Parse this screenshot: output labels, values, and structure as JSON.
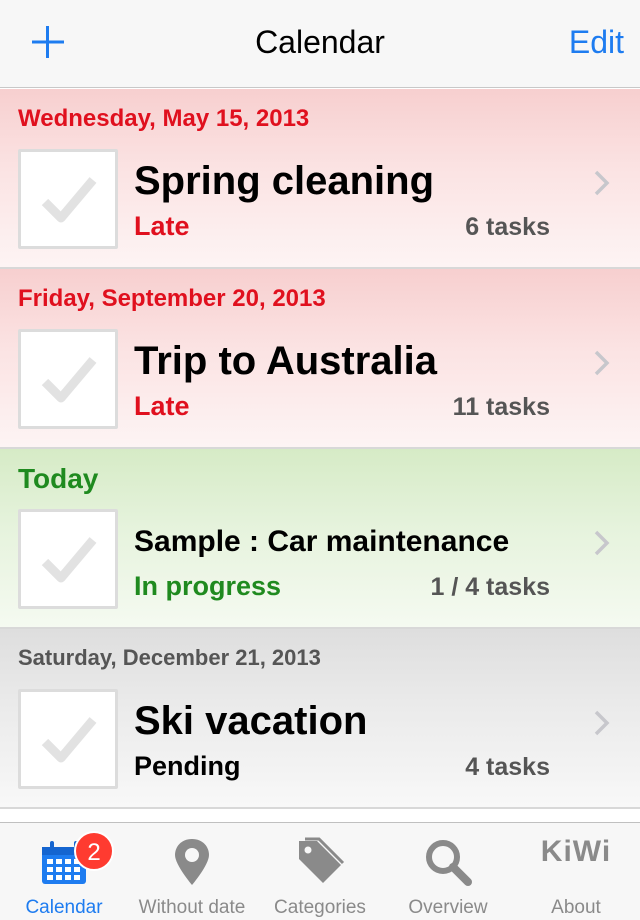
{
  "navbar": {
    "title": "Calendar",
    "edit_label": "Edit",
    "add_icon": "plus-icon",
    "accent": "#1e7cf0"
  },
  "sections": [
    {
      "date": "Wednesday, May 15, 2013",
      "title": "Spring cleaning",
      "status": "Late",
      "count": "6 tasks",
      "kind": "late"
    },
    {
      "date": "Friday, September 20, 2013",
      "title": "Trip to Australia",
      "status": "Late",
      "count": "11 tasks",
      "kind": "late"
    },
    {
      "date": "Today",
      "title": "Sample : Car maintenance",
      "status": "In progress",
      "count": "1 / 4 tasks",
      "kind": "today"
    },
    {
      "date": "Saturday, December 21, 2013",
      "title": "Ski vacation",
      "status": "Pending",
      "count": "4 tasks",
      "kind": "pending"
    }
  ],
  "colors": {
    "late": "#e0101e",
    "today": "#1f8a1f",
    "pending": "#000000"
  },
  "tabbar": {
    "tabs": [
      {
        "label": "Calendar",
        "icon": "calendar-icon",
        "badge": "2",
        "active": true
      },
      {
        "label": "Without date",
        "icon": "location-pin-icon",
        "active": false
      },
      {
        "label": "Categories",
        "icon": "tags-icon",
        "active": false
      },
      {
        "label": "Overview",
        "icon": "search-icon",
        "active": false
      },
      {
        "label": "About",
        "icon": "kiwi-logo-icon",
        "logo_text": "KiWi",
        "active": false
      }
    ]
  }
}
